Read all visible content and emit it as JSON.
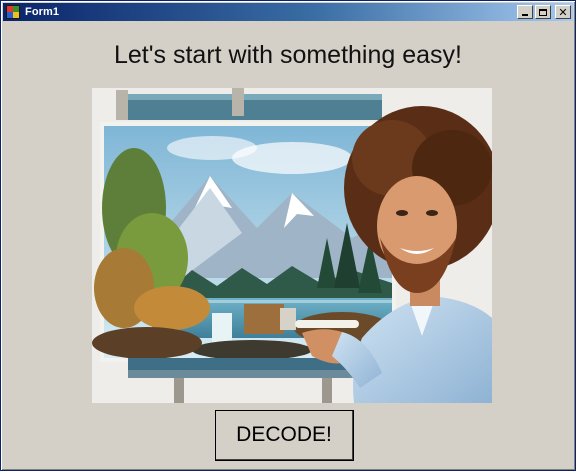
{
  "window": {
    "title": "Form1",
    "icon": "windows-forms-app-icon"
  },
  "title_buttons": {
    "minimize_icon": "minimize-icon",
    "maximize_icon": "maximize-icon",
    "close_icon": "close-icon"
  },
  "main": {
    "heading": "Let's start with something easy!",
    "image": "painter-at-easel-photo",
    "decode_button_label": "DECODE!"
  },
  "colors": {
    "title_bar_start": "#0a246a",
    "title_bar_end": "#a6caf0",
    "window_face": "#d4d0c8"
  }
}
